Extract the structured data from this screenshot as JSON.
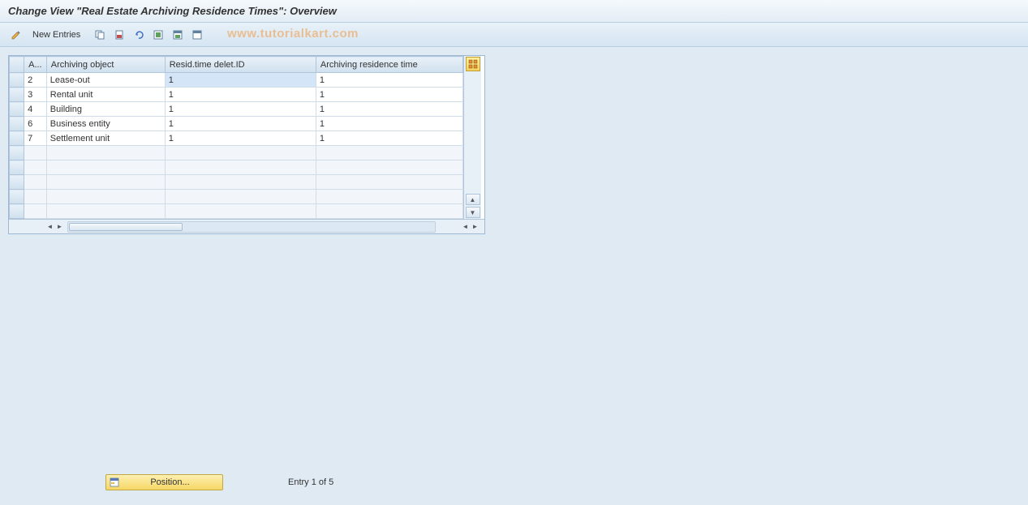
{
  "title": "Change View \"Real Estate Archiving Residence Times\": Overview",
  "toolbar": {
    "new_entries_label": "New Entries"
  },
  "watermark": "www.tutorialkart.com",
  "table": {
    "headers": {
      "a": "A...",
      "object": "Archiving object",
      "resid": "Resid.time delet.ID",
      "arch": "Archiving residence time"
    },
    "rows": [
      {
        "a": "2",
        "object": "Lease-out",
        "resid": "1",
        "arch": "1",
        "resid_highlight": true
      },
      {
        "a": "3",
        "object": "Rental unit",
        "resid": "1",
        "arch": "1"
      },
      {
        "a": "4",
        "object": "Building",
        "resid": "1",
        "arch": "1"
      },
      {
        "a": "6",
        "object": "Business entity",
        "resid": "1",
        "arch": "1"
      },
      {
        "a": "7",
        "object": "Settlement unit",
        "resid": "1",
        "arch": "1"
      }
    ],
    "empty_rows": 5
  },
  "footer": {
    "position_label": "Position...",
    "entry_text": "Entry 1 of 5"
  }
}
